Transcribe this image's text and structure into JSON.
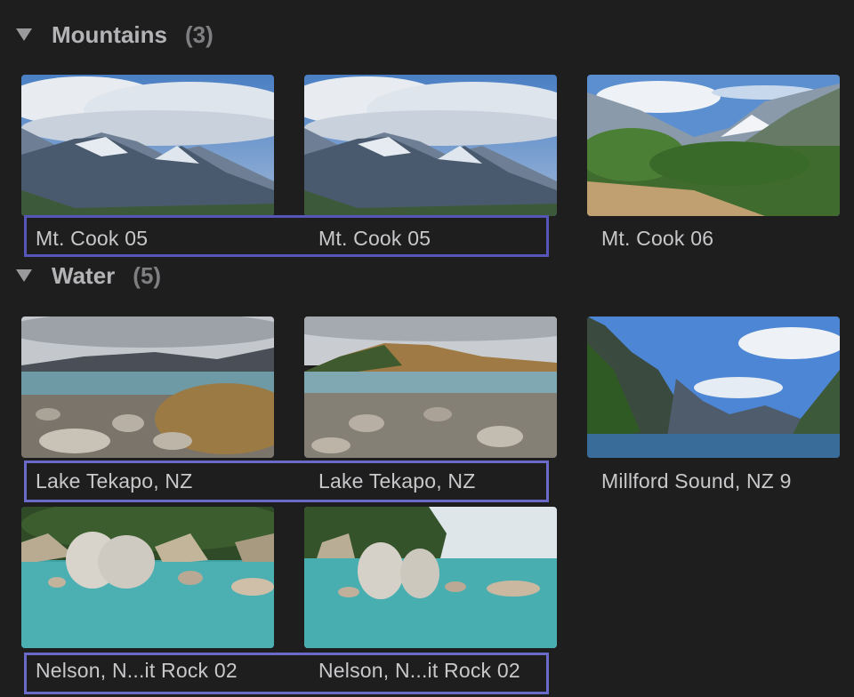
{
  "sections": {
    "mountains": {
      "title": "Mountains",
      "count": "(3)",
      "clips": [
        {
          "name": "Mt. Cook 05",
          "thumbnail": "mountain-clouds-image",
          "selected": true
        },
        {
          "name": "Mt. Cook 05",
          "thumbnail": "mountain-clouds-image",
          "selected": true
        },
        {
          "name": "Mt. Cook 06",
          "thumbnail": "mountain-valley-image",
          "selected": false
        }
      ]
    },
    "water": {
      "title": "Water",
      "count": "(5)",
      "clips": [
        {
          "name": "Lake Tekapo, NZ",
          "thumbnail": "lake-shore-image",
          "selected": true
        },
        {
          "name": "Lake Tekapo, NZ",
          "thumbnail": "lake-shore-image",
          "selected": true
        },
        {
          "name": "Millford Sound, NZ 9",
          "thumbnail": "fjord-image",
          "selected": false
        },
        {
          "name": "Nelson, N...it Rock 02",
          "thumbnail": "split-rock-image",
          "selected": true
        },
        {
          "name": "Nelson, N...it Rock 02",
          "thumbnail": "split-rock-image",
          "selected": true
        }
      ]
    }
  },
  "colors": {
    "background": "#1e1e1f",
    "selection_border": "#5656b8",
    "text": "#c8c8ca",
    "header_text": "#b4b4b6",
    "count_text": "#7f7f82"
  }
}
